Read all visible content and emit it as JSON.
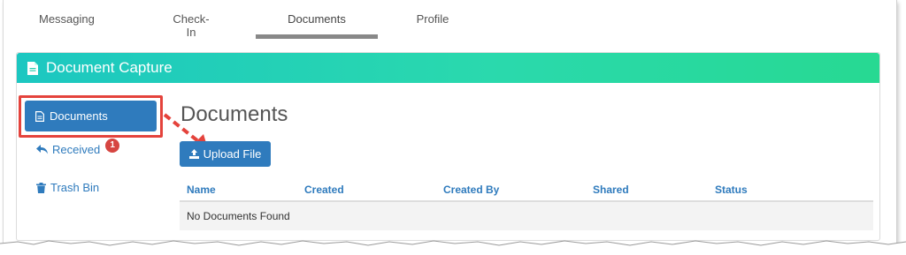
{
  "tabs": [
    "Messaging",
    "Check-In",
    "Documents",
    "Profile"
  ],
  "active_tab": "Documents",
  "panel": {
    "title": "Document Capture"
  },
  "sidebar": {
    "items": [
      {
        "label": "Documents",
        "icon": "document-icon"
      },
      {
        "label": "Received",
        "icon": "reply-icon",
        "badge": "1"
      },
      {
        "label": "Trash Bin",
        "icon": "trash-icon"
      }
    ]
  },
  "main": {
    "title": "Documents",
    "upload_label": "Upload File",
    "table": {
      "columns": [
        "Name",
        "Created",
        "Created By",
        "Shared",
        "Status"
      ],
      "empty_text": "No Documents Found"
    }
  },
  "colors": {
    "accent": "#2f7bbd",
    "header_gradient_start": "#1cc7c1",
    "header_gradient_end": "#27d992",
    "highlight": "#e4433c",
    "badge": "#d64541"
  }
}
